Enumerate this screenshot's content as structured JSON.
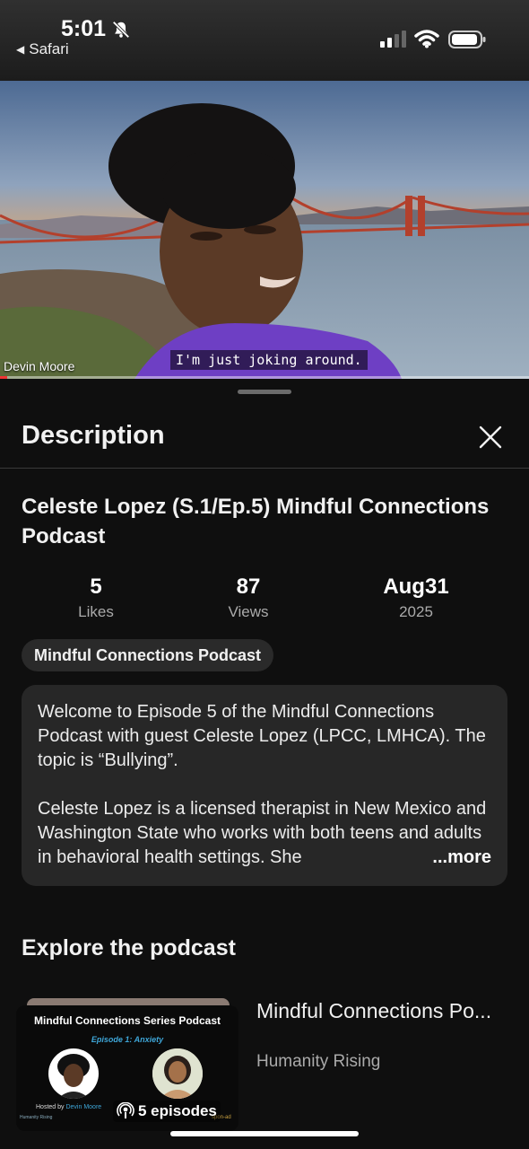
{
  "status_bar": {
    "time": "5:01",
    "back_label": "Safari",
    "bell_icon": "bell-slash-icon",
    "signal_icon": "cellular-signal-icon",
    "wifi_icon": "wifi-icon",
    "battery_icon": "battery-icon"
  },
  "video": {
    "speaker_name": "Devin Moore",
    "caption": "I'm just joking around.",
    "progress_played": 0.01
  },
  "sheet": {
    "title": "Description",
    "close_icon": "close-icon",
    "video_title": "Celeste Lopez (S.1/Ep.5) Mindful Connections Podcast",
    "stats": [
      {
        "value": "5",
        "label": "Likes"
      },
      {
        "value": "87",
        "label": "Views"
      },
      {
        "value": "Aug31",
        "label": "2025"
      }
    ],
    "chip": "Mindful Connections Podcast",
    "description": {
      "paragraph1": "Welcome to Episode 5 of the Mindful Connections Podcast with guest Celeste Lopez (LPCC, LMHCA). The topic is “Bullying”.",
      "paragraph2": "Celeste Lopez is a licensed therapist in New Mexico and Washington State who works with both teens and adults in behavioral health settings. She",
      "more": "...more"
    },
    "explore_heading": "Explore the podcast",
    "podcast": {
      "thumb_title": "Mindful Connections Series Podcast",
      "thumb_episode": "Episode 1: Anxiety",
      "thumb_hosted_prefix": "Hosted by",
      "thumb_hosted_name": "Devin Moore",
      "thumb_logo_left": "Humanity Rising",
      "thumb_logo_right": "spon-ad",
      "episodes_icon": "podcast-icon",
      "episodes": "5 episodes",
      "name": "Mindful Connections Po...",
      "author": "Humanity Rising"
    }
  },
  "colors": {
    "background": "#0f0f0f",
    "card": "#272727",
    "chip": "#2a2a2a",
    "secondary_text": "#aaaaaa",
    "accent_blue": "#3ea6d8"
  }
}
